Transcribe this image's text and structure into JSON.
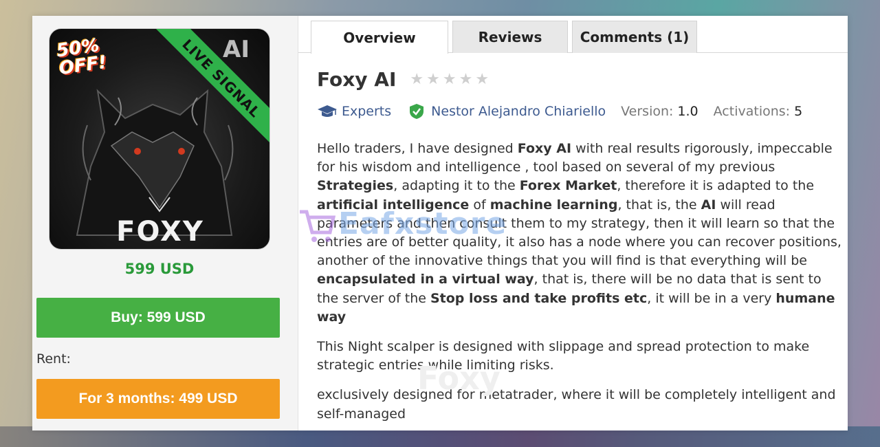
{
  "left": {
    "image": {
      "badge_discount": "50% OFF!",
      "banner": "LIVE SIGNAL",
      "corner_text": "AI",
      "brand_text": "FOXY"
    },
    "price": "599 USD",
    "buy_label": "Buy: 599 USD",
    "rent_label": "Rent:",
    "rent_button_label": "For 3 months: 499 USD"
  },
  "tabs": [
    {
      "label": "Overview",
      "active": true
    },
    {
      "label": "Reviews",
      "active": false
    },
    {
      "label": "Comments (1)",
      "active": false
    }
  ],
  "product": {
    "title": "Foxy AI",
    "rating": 0,
    "category": "Experts",
    "author": "Nestor Alejandro Chiariello",
    "version_key": "Version:",
    "version_val": "1.0",
    "activations_key": "Activations:",
    "activations_val": "5"
  },
  "description": {
    "p1": [
      {
        "t": "Hello traders, I have designed ",
        "b": false
      },
      {
        "t": "Foxy AI",
        "b": true
      },
      {
        "t": " with real results rigorously, impeccable for his wisdom and intelligence , tool based on several of my previous ",
        "b": false
      },
      {
        "t": "Strategies",
        "b": true
      },
      {
        "t": ", adapting it to the ",
        "b": false
      },
      {
        "t": "Forex Market",
        "b": true
      },
      {
        "t": ", therefore it is adapted to the ",
        "b": false
      },
      {
        "t": "artificial intelligence",
        "b": true
      },
      {
        "t": " of ",
        "b": false
      },
      {
        "t": "machine learning",
        "b": true
      },
      {
        "t": ", that is, the ",
        "b": false
      },
      {
        "t": "AI",
        "b": true
      },
      {
        "t": " will read parameters and then consult them to my strategy, then it will learn so that the entries are of better quality, it also has a node where you can recover positions, another of the innovative things that you will find is that everything will be ",
        "b": false
      },
      {
        "t": "encapsulated in a virtual way",
        "b": true
      },
      {
        "t": ", that is, there will be no data that is sent to the server of the ",
        "b": false
      },
      {
        "t": "Stop loss and take profits etc",
        "b": true
      },
      {
        "t": ", it will be in a very ",
        "b": false
      },
      {
        "t": "humane way",
        "b": true
      }
    ],
    "p2": "This Night scalper is designed with slippage and spread protection to make strategic entries while limiting risks.",
    "p3": "exclusively designed for metatrader, where it will be completely intelligent and self-managed"
  },
  "watermark": {
    "text": "Eafxstore",
    "faint": "Foxy"
  },
  "icons": [
    "graduation-cap-icon",
    "verified-shield-icon",
    "star-icon",
    "cart-icon"
  ],
  "colors": {
    "price_green": "#2a9a3a",
    "buy_green": "#46b044",
    "rent_orange": "#f39b1f",
    "link_blue": "#3d5a8f",
    "verified_green": "#3aa74a",
    "banner_green": "#2fb14a"
  }
}
